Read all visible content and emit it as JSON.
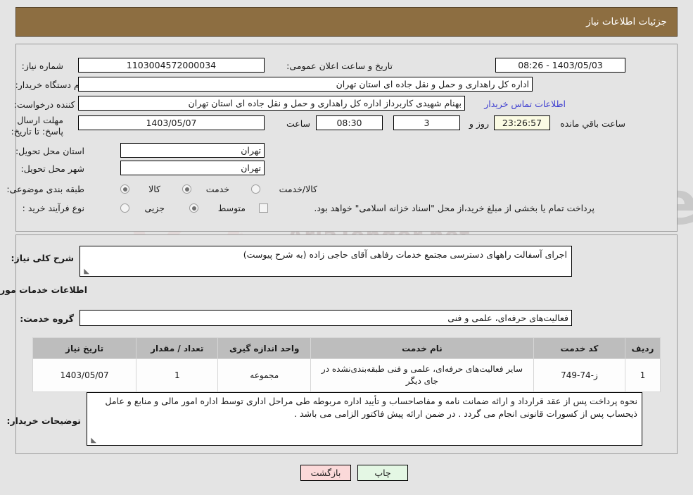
{
  "header": {
    "title": "جزئیات اطلاعات نیاز"
  },
  "form": {
    "need_number_label": "شماره نیاز:",
    "need_number_value": "1103004572000034",
    "announce_datetime_label": "تاریخ و ساعت اعلان عمومی:",
    "announce_datetime_value": "1403/05/03 - 08:26",
    "buyer_org_label": "نام دستگاه خریدار:",
    "buyer_org_value": "اداره کل راهداری و حمل و نقل جاده ای استان تهران",
    "requester_label": "ایجاد کننده درخواست:",
    "requester_value": "بهنام شهیدی کاربرداز اداره کل راهداری و حمل و نقل جاده ای استان تهران",
    "buyer_contact_link": "اطلاعات تماس خریدار",
    "deadline_label": "مهلت ارسال پاسخ: تا تاریخ:",
    "deadline_date_value": "1403/05/07",
    "deadline_hour_label": "ساعت",
    "deadline_hour_value": "08:30",
    "remaining_days_value": "3",
    "days_and_label": "روز و",
    "remaining_time_value": "23:26:57",
    "remaining_suffix_label": "ساعت باقي مانده",
    "province_label": "استان محل تحویل:",
    "province_value": "تهران",
    "city_label": "شهر محل تحویل:",
    "city_value": "تهران",
    "category_label": "طبقه بندی موضوعی:",
    "category_options": [
      {
        "label": "کالا",
        "selected": false
      },
      {
        "label": "خدمت",
        "selected": true
      },
      {
        "label": "کالا/خدمت",
        "selected": false
      }
    ],
    "process_label": "نوع فرآیند خرید :",
    "process_options": [
      {
        "label": "جزیی",
        "selected": false
      },
      {
        "label": "متوسط",
        "selected": true
      }
    ],
    "treasury_checkbox_checked": false,
    "treasury_note": "پرداخت تمام یا بخشی از مبلغ خرید،از محل \"اسناد خزانه اسلامی\" خواهد بود."
  },
  "details": {
    "general_desc_label": "شرح کلی نیاز:",
    "general_desc_value": "اجرای آسفالت راههای دسترسی مجتمع خدمات رفاهی آقای حاجی زاده (به شرح پیوست)",
    "services_info_title": "اطلاعات خدمات مورد نیاز",
    "service_group_label": "گروه خدمت:",
    "service_group_value": "فعالیت‌های حرفه‌ای، علمی و فنی"
  },
  "table": {
    "columns": [
      "ردیف",
      "کد خدمت",
      "نام خدمت",
      "واحد اندازه گیری",
      "تعداد / مقدار",
      "تاریخ نیاز"
    ],
    "rows": [
      {
        "radif": "1",
        "code": "ز-74-749",
        "name": "سایر فعالیت‌های حرفه‌ای، علمی و فنی طبقه‌بندی‌نشده در جای دیگر",
        "unit": "مجموعه",
        "qty": "1",
        "date": "1403/05/07"
      }
    ]
  },
  "notes": {
    "buyer_notes_label": "توضیحات خریدار:",
    "buyer_notes_value": "نحوه پرداخت پس از عقد قرارداد و ارائه ضمانت نامه و مفاصاحساب و تأیید اداره مربوطه طی مراحل اداری توسط اداره امور مالی و منابع و عامل ذیحساب پس از کسورات قانونی انجام می گردد . در ضمن ارائه پیش فاکتور الزامی می باشد ."
  },
  "buttons": {
    "print_label": "چاپ",
    "back_label": "بازگشت"
  },
  "watermark": {
    "brand_text": "AriaTender.net"
  },
  "colors": {
    "header_bg": "#8d6e41",
    "page_bg": "#e4e4e4",
    "link": "#3f3fd0",
    "table_header_bg": "#bdbdbd",
    "print_btn_bg": "#e4f7e4",
    "back_btn_bg": "#fbd9d9",
    "timer_bg": "#fbfbe3"
  }
}
